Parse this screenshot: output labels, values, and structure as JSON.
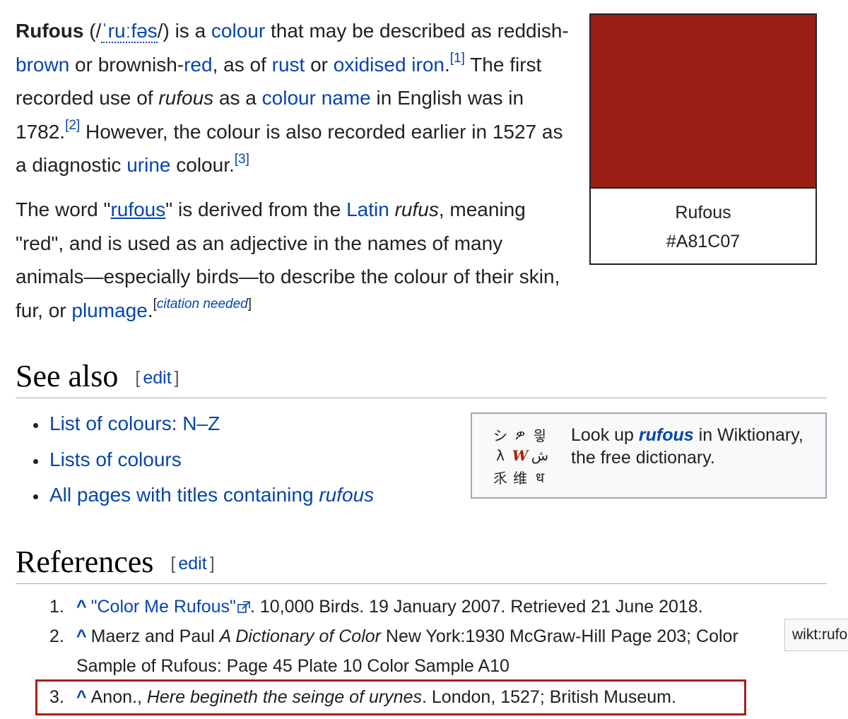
{
  "lead": {
    "p1": {
      "term": "Rufous",
      "ipa_open": " (/",
      "ipa": "ˈruːfəs",
      "ipa_close": "/) is a ",
      "link_colour": "colour",
      "t1": " that may be described as reddish-",
      "link_brown": "brown",
      "t2": " or brownish-",
      "link_red": "red",
      "t3": ", as of ",
      "link_rust": "rust",
      "t4": " or ",
      "link_oxidised_iron": "oxidised iron",
      "t5": ".",
      "ref1": "[1]",
      "t6": " The first recorded use of ",
      "italic_rufous": "rufous",
      "t7": " as a ",
      "link_colour_name": "colour name",
      "t8": " in English was in 1782.",
      "ref2": "[2]",
      "t9": " However, the colour is also recorded earlier in 1527 as a diagnostic ",
      "link_urine": "urine",
      "t10": " colour.",
      "ref3": "[3]"
    },
    "p2": {
      "t1": "The word \"",
      "link_rufous": "rufous",
      "t2": "\" is derived from the ",
      "link_latin": "Latin",
      "t3": " ",
      "italic_rufus": "rufus",
      "t4": ", meaning \"red\", and is used as an adjective in the names of many animals—especially birds—to describe the colour of their skin, fur, or ",
      "link_plumage": "plumage",
      "t5": ".",
      "cn_open": "[",
      "cn_text": "citation needed",
      "cn_close": "]"
    }
  },
  "infobox": {
    "swatch_color": "#9c1f16",
    "name": "Rufous",
    "hex": "#A81C07"
  },
  "see_also": {
    "heading": "See also",
    "edit_open": "[",
    "edit": "edit",
    "edit_close": "]",
    "items": [
      {
        "label": "List of colours: N–Z"
      },
      {
        "label": "Lists of colours"
      },
      {
        "label": "All pages with titles containing ",
        "italic": "rufous"
      }
    ]
  },
  "wiktionary": {
    "logo_glyphs": [
      "シ",
      "ዎ",
      "읳",
      "λ",
      "W",
      "ش",
      "乑",
      "维",
      "ध"
    ],
    "t1": "Look up ",
    "term": "rufous",
    "t2": " in Wiktionary, the free dictionary."
  },
  "references": {
    "heading": "References",
    "edit_open": "[",
    "edit": "edit",
    "edit_close": "]",
    "items": [
      {
        "num": "1.",
        "caret": "^",
        "title": "\"Color Me Rufous\"",
        "rest": ". 10,000 Birds. 19 January 2007. Retrieved 21 June 2018."
      },
      {
        "num": "2.",
        "caret": "^",
        "t1": "Maerz and Paul ",
        "italic": "A Dictionary of Color",
        "t2": " New York:1930 McGraw-Hill Page 203; Color",
        "line2": "Sample of Rufous: Page 45 Plate 10 Color Sample A10"
      },
      {
        "num": "3.",
        "caret": "^",
        "t1": "Anon., ",
        "italic": "Here begineth the seinge of urynes",
        "t2": ". London, 1527; British Museum."
      }
    ]
  },
  "tooltip": "wikt:rufous",
  "highlight_color": "#a8201a"
}
